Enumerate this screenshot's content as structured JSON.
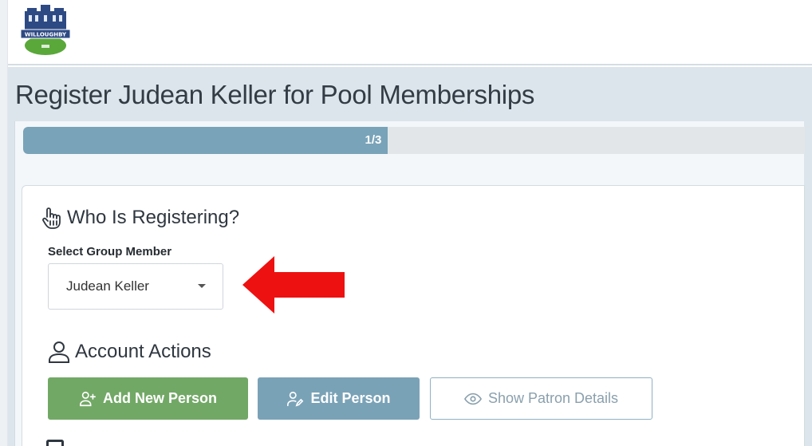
{
  "header": {
    "logo_text": "WILLOUGHBY",
    "logo_icon": "city-hall-logo"
  },
  "page": {
    "title": "Register Judean Keller for Pool Memberships"
  },
  "progress": {
    "label": "1/3",
    "fraction": 0.4667,
    "fill_color": "#79a3b8"
  },
  "who_section": {
    "icon": "pointer-hand-icon",
    "heading": "Who Is Registering?",
    "field_label": "Select Group Member",
    "selected_value": "Judean Keller"
  },
  "annotation": {
    "icon": "red-arrow-left",
    "color": "#ee1111"
  },
  "account_actions": {
    "icon": "user-outline-icon",
    "heading": "Account Actions",
    "add_label": "Add New Person",
    "edit_label": "Edit Person",
    "show_label": "Show Patron Details"
  },
  "colors": {
    "green": "#72a866",
    "steel_blue": "#7aa2b7",
    "band": "#dde5ec"
  }
}
